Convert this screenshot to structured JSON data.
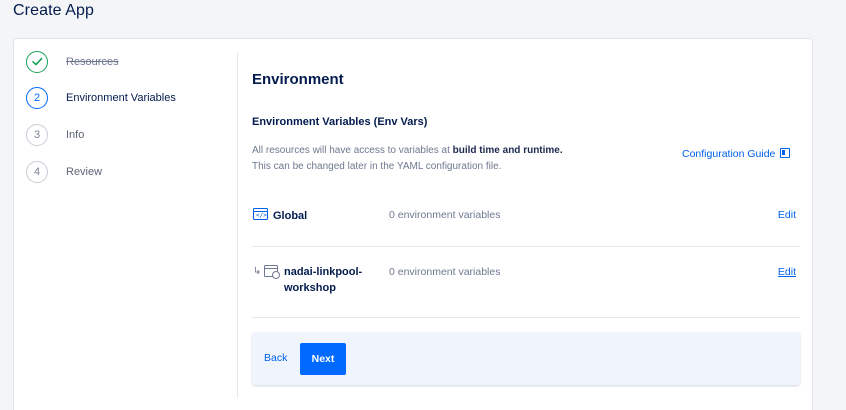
{
  "page": {
    "title": "Create App"
  },
  "steps": [
    {
      "label": "Resources",
      "status": "done",
      "icon": "check-icon"
    },
    {
      "number": "2",
      "label": "Environment Variables",
      "status": "active"
    },
    {
      "number": "3",
      "label": "Info",
      "status": "todo"
    },
    {
      "number": "4",
      "label": "Review",
      "status": "todo"
    }
  ],
  "main": {
    "section_title": "Environment",
    "sub_title": "Environment Variables (Env Vars)",
    "desc_line1_prefix": "All resources will have access to variables at ",
    "desc_line1_bold": "build time and runtime.",
    "desc_line2": "This can be changed later in the YAML configuration file.",
    "config_guide_label": "Configuration Guide",
    "config_guide_icon": "book-icon"
  },
  "env_rows": [
    {
      "name": "Global",
      "count": "0 environment variables",
      "edit_label": "Edit",
      "icon": "code-window-icon"
    },
    {
      "name_line1": "nadai-linkpool-",
      "name_line2": "workshop",
      "count": "0 environment variables",
      "edit_label": "Edit",
      "icon": "web-component-icon"
    }
  ],
  "footer": {
    "back_label": "Back",
    "next_label": "Next"
  },
  "colors": {
    "accent": "#0069ff",
    "link": "#0061eb",
    "success": "#15a05a",
    "heading": "#031b4e"
  }
}
